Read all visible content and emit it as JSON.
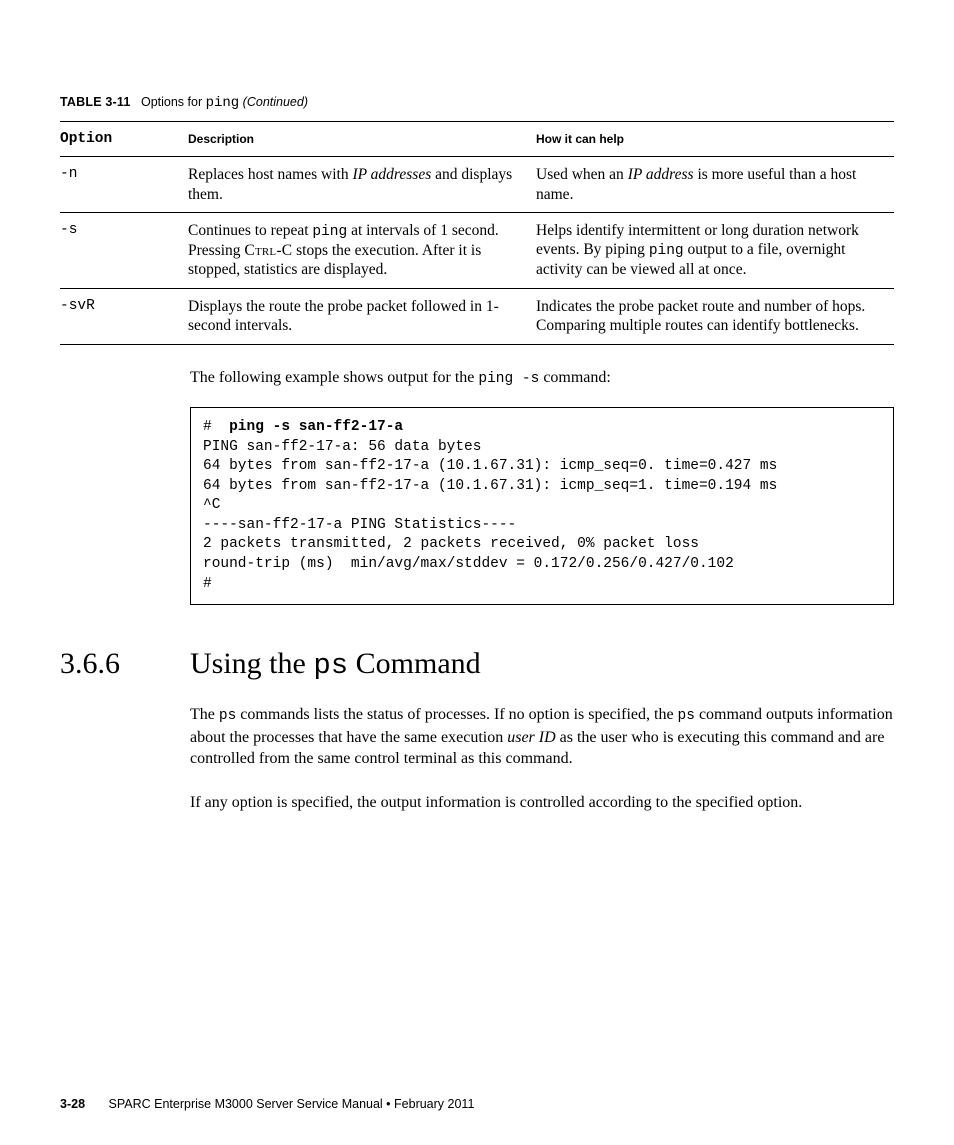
{
  "table_caption": {
    "label": "TABLE 3-11",
    "title_pre": "Options for ",
    "title_mono": "ping",
    "title_cont": " (Continued)"
  },
  "table": {
    "headers": [
      "Option",
      "Description",
      "How it can help"
    ],
    "rows": [
      {
        "option": "-n",
        "desc": "Replaces host names with <span class=\"ital\">IP addresses</span> and displays them.",
        "help": "Used when an <span class=\"ital\">IP address</span> is more useful than a host name."
      },
      {
        "option": "-s",
        "desc": "Continues to repeat <span class=\"mono-inline\">ping</span> at intervals of 1 second. Pressing <span class=\"smallcaps\">Ctrl-C</span> stops the execution. After it is stopped, statistics are displayed.",
        "help": "Helps identify intermittent or long duration network events. By piping <span class=\"mono-inline\">ping</span> output to a file, overnight activity can be viewed all at once."
      },
      {
        "option": "-svR",
        "desc": "Displays the route the probe packet followed in 1-second intervals.",
        "help": "Indicates the probe packet route and number of hops. Comparing multiple routes can identify bottlenecks."
      }
    ]
  },
  "intro_text": {
    "pre": "The following example shows output for the ",
    "mono": "ping -s",
    "post": " command:"
  },
  "code": {
    "prompt": "#  ",
    "cmd": "ping -s san-ff2-17-a",
    "body": "PING san-ff2-17-a: 56 data bytes\n64 bytes from san-ff2-17-a (10.1.67.31): icmp_seq=0. time=0.427 ms\n64 bytes from san-ff2-17-a (10.1.67.31): icmp_seq=1. time=0.194 ms\n^C\n----san-ff2-17-a PING Statistics----\n2 packets transmitted, 2 packets received, 0% packet loss\nround-trip (ms)  min/avg/max/stddev = 0.172/0.256/0.427/0.102\n#"
  },
  "section": {
    "number": "3.6.6",
    "title_pre": "Using the ",
    "title_mono": "ps",
    "title_post": " Command"
  },
  "para1": {
    "a": "The ",
    "m1": "ps",
    "b": " commands lists the status of processes. If no option is specified, the ",
    "m2": "ps",
    "c": " command outputs information about the processes that have the same execution ",
    "ital": "user ID",
    "d": " as the user who is executing this command and are controlled from the same control terminal as this command."
  },
  "para2": "If any option is specified, the output information is controlled according to the specified option.",
  "footer": {
    "pagenum": "3-28",
    "text": "SPARC Enterprise M3000 Server Service Manual • February 2011"
  }
}
